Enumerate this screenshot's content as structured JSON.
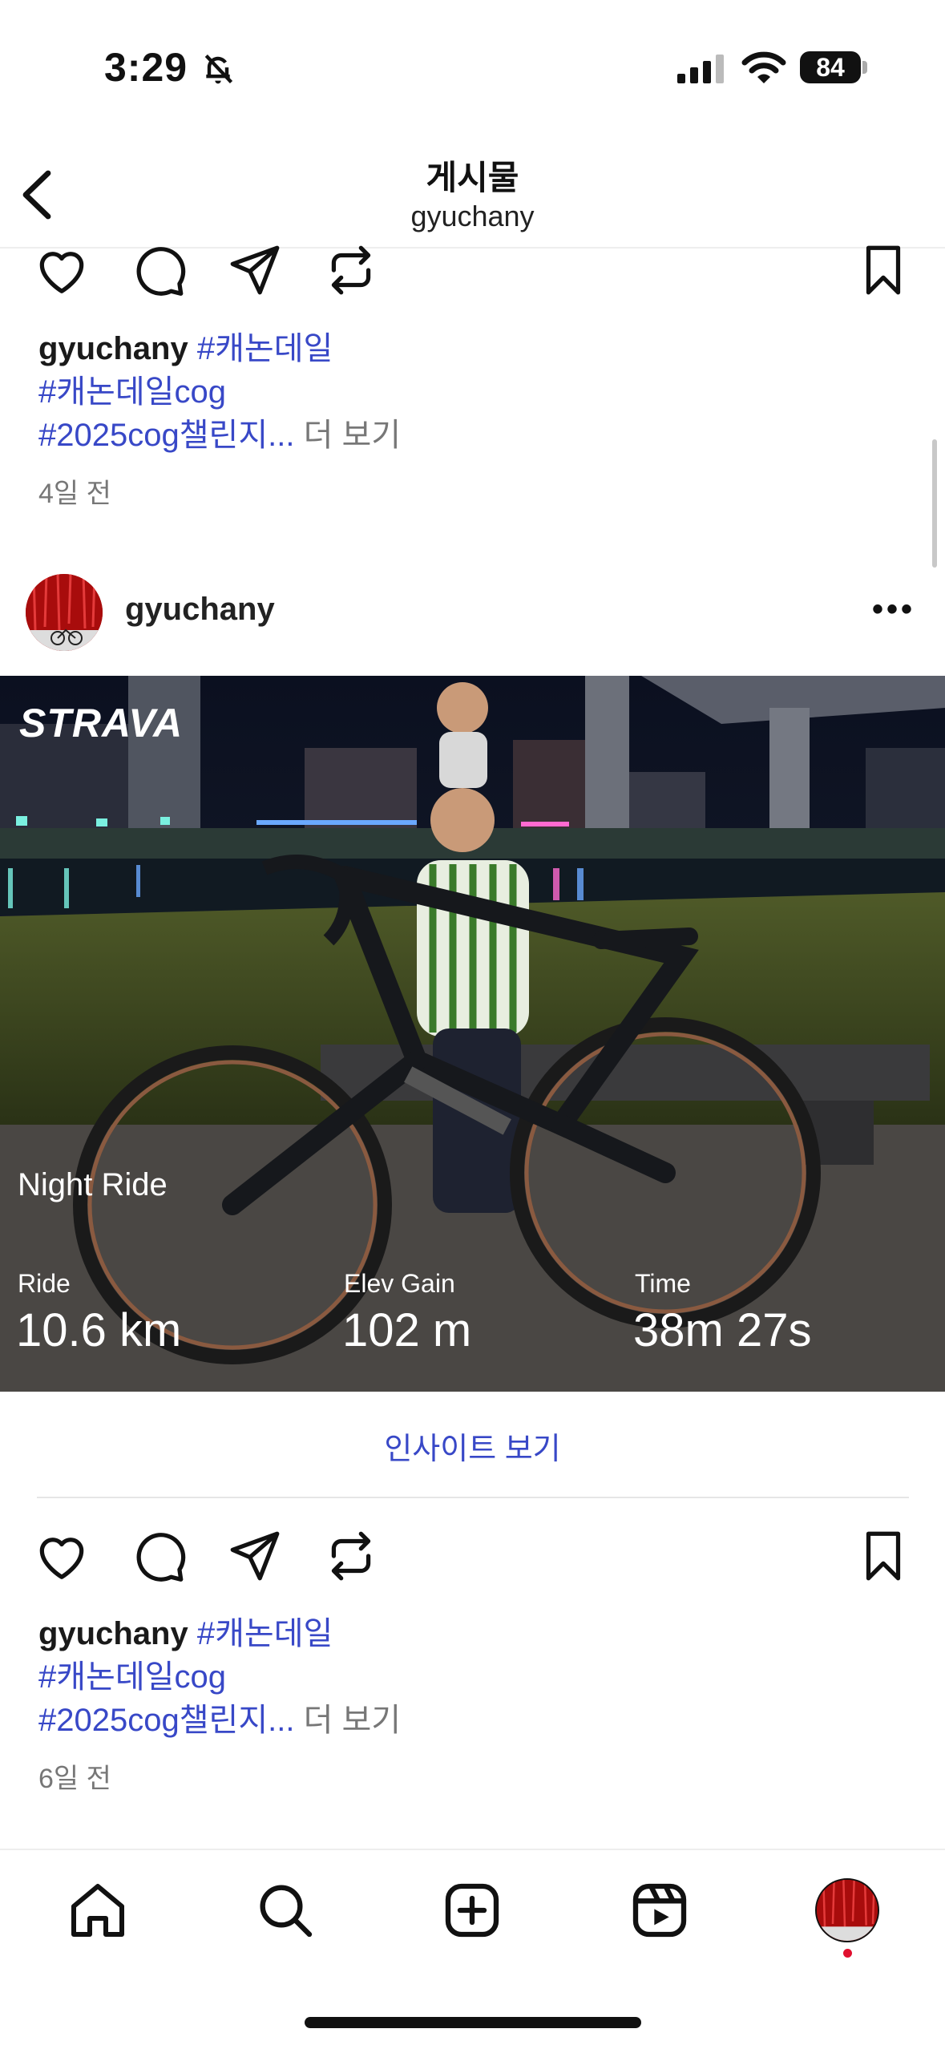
{
  "status": {
    "time": "3:29",
    "battery": "84"
  },
  "header": {
    "title": "게시물",
    "username": "gyuchany"
  },
  "post_prev": {
    "caption_user": "gyuchany",
    "tags_line1": "#캐논데일",
    "tags_line2": "#캐논데일cog",
    "tags_line3": "#2025cog챌린지...",
    "more": "더 보기",
    "time_ago": "4일 전"
  },
  "post": {
    "username": "gyuchany",
    "image": {
      "brand": "STRAVA",
      "activity_name": "Night Ride",
      "stats": [
        {
          "label": "Ride",
          "value": "10.6 km"
        },
        {
          "label": "Elev Gain",
          "value": "102 m"
        },
        {
          "label": "Time",
          "value": "38m 27s"
        }
      ]
    },
    "insights": "인사이트 보기",
    "caption_user": "gyuchany",
    "tags_line1": "#캐논데일",
    "tags_line2": "#캐논데일cog",
    "tags_line3": "#2025cog챌린지...",
    "more": "더 보기",
    "time_ago": "6일 전"
  },
  "icons": {
    "actions": [
      "heart-icon",
      "comment-icon",
      "share-icon",
      "repost-icon",
      "bookmark-icon"
    ],
    "nav": [
      "home-icon",
      "search-icon",
      "create-icon",
      "reels-icon",
      "profile-avatar"
    ]
  },
  "colors": {
    "link": "#3848c7",
    "text_muted": "#777777",
    "notification_dot": "#e0102f"
  }
}
